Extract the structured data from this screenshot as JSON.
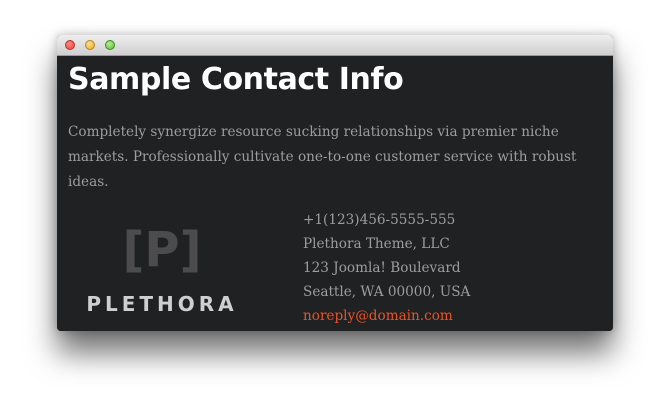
{
  "window": {
    "buttons": {
      "close": "close-button",
      "minimize": "minimize-button",
      "maximize": "maximize-button"
    }
  },
  "page": {
    "title": "Sample Contact Info",
    "description": "Completely synergize resource sucking relationships via premier niche markets. Professionally cultivate one-to-one customer service with robust ideas."
  },
  "logo": {
    "mark": "[P]",
    "wordmark": "PLETHORA"
  },
  "contact": {
    "phone": "+1(123)456-5555-555",
    "company": "Plethora Theme, LLC",
    "street": "123 Joomla! Boulevard",
    "city": "Seattle, WA 00000, USA",
    "email": "noreply@domain.com"
  },
  "colors": {
    "background": "#202123",
    "title": "#ffffff",
    "body_text": "#9d9d9d",
    "email_link": "#e8532a",
    "logo_mark": "#4c4c4e",
    "logo_word": "#cfcfcf"
  }
}
